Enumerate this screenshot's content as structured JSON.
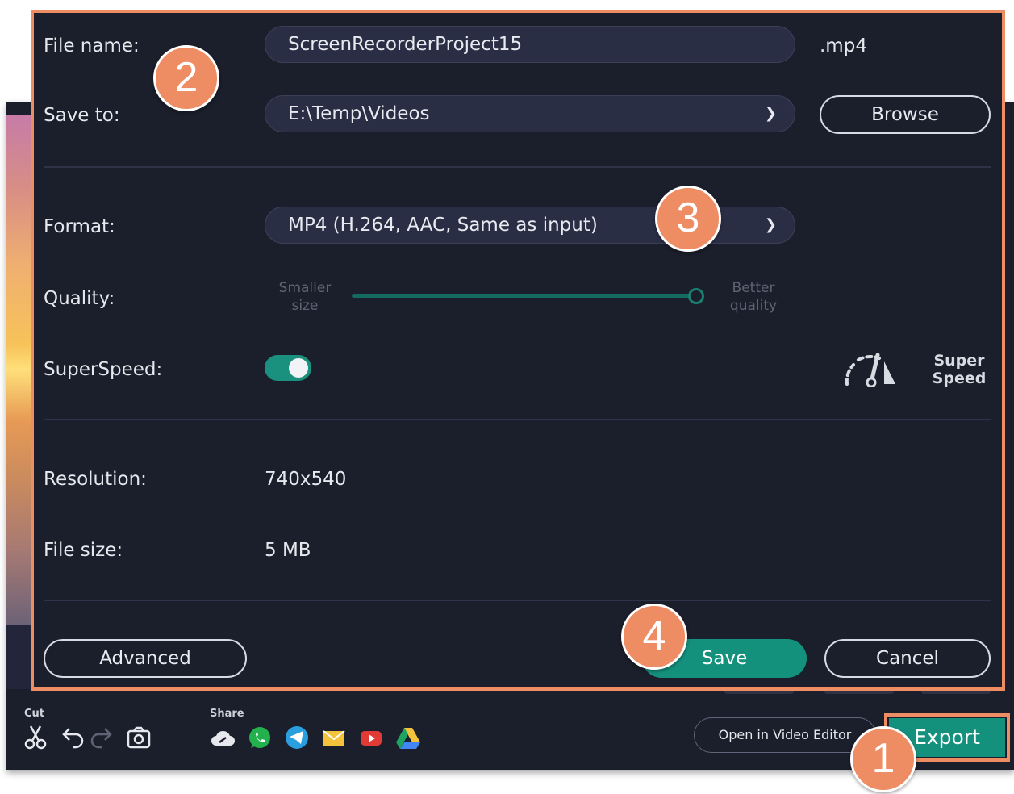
{
  "dialog": {
    "file_name_label": "File name:",
    "file_name_value": "ScreenRecorderProject15",
    "file_extension": ".mp4",
    "save_to_label": "Save to:",
    "save_to_value": "E:\\Temp\\Videos",
    "browse_label": "Browse",
    "format_label": "Format:",
    "format_value": "MP4 (H.264, AAC, Same as input)",
    "quality_label": "Quality:",
    "quality_min_line1": "Smaller",
    "quality_min_line2": "size",
    "quality_max_line1": "Better",
    "quality_max_line2": "quality",
    "quality_level": 1.0,
    "superspeed_label": "SuperSpeed:",
    "superspeed_enabled": true,
    "superspeed_icon": "speedometer-icon",
    "superspeed_caption_line1": "Super",
    "superspeed_caption_line2": "Speed",
    "resolution_label": "Resolution:",
    "resolution_value": "740x540",
    "file_size_label": "File size:",
    "file_size_value": "5 MB",
    "advanced_label": "Advanced",
    "save_label": "Save",
    "cancel_label": "Cancel"
  },
  "callouts": [
    "1",
    "2",
    "3",
    "4"
  ],
  "toolbar": {
    "cut_caption": "Cut",
    "share_caption": "Share",
    "edit_icons": [
      "scissors-icon",
      "undo-icon",
      "redo-icon",
      "snapshot-icon"
    ],
    "share_icons": [
      "cloud-icon",
      "whatsapp-icon",
      "telegram-icon",
      "email-icon",
      "youtube-icon",
      "google-drive-icon"
    ],
    "open_editor_label": "Open in Video Editor",
    "export_label": "Export"
  },
  "colors": {
    "accent": "#14917d",
    "callout": "#ee8c63",
    "dialog_bg": "#1b1e2b"
  }
}
